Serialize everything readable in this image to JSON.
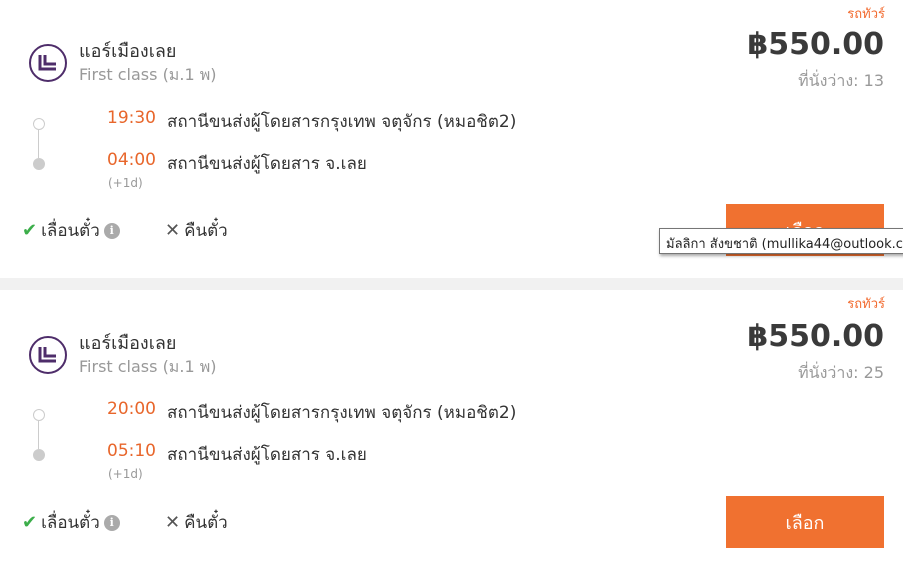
{
  "trips": [
    {
      "bus_type": "รถทัวร์",
      "operator": "แอร์เมืองเลย",
      "class": "First class (ม.1 พ)",
      "price": "฿550.00",
      "seats": "ที่นั่งว่าง: 13",
      "departure_time": "19:30",
      "departure_station": "สถานีขนส่งผู้โดยสารกรุงเทพ จตุจักร (หมอชิต2)",
      "arrival_time": "04:00",
      "arrival_station": "สถานีขนส่งผู้โดยสาร จ.เลย",
      "arrival_day_offset": "(+1d)",
      "reschedule_label": "เลื่อนตั๋ว",
      "refund_label": "คืนตั๋ว",
      "select_label": "เลือก"
    },
    {
      "bus_type": "รถทัวร์",
      "operator": "แอร์เมืองเลย",
      "class": "First class (ม.1 พ)",
      "price": "฿550.00",
      "seats": "ที่นั่งว่าง: 25",
      "departure_time": "20:00",
      "departure_station": "สถานีขนส่งผู้โดยสารกรุงเทพ จตุจักร (หมอชิต2)",
      "arrival_time": "05:10",
      "arrival_station": "สถานีขนส่งผู้โดยสาร จ.เลย",
      "arrival_day_offset": "(+1d)",
      "reschedule_label": "เลื่อนตั๋ว",
      "refund_label": "คืนตั๋ว",
      "select_label": "เลือก"
    }
  ],
  "tooltip": {
    "text": "มัลลิกา สังขชาติ (mullika44@outlook.c"
  },
  "colors": {
    "accent": "#f07130",
    "time": "#e8662b",
    "check": "#3cae4a",
    "logo": "#4e2d6a"
  },
  "icons": {
    "logo": "operator-logo",
    "check": "check-icon",
    "info": "info-icon",
    "cross": "close-icon"
  }
}
